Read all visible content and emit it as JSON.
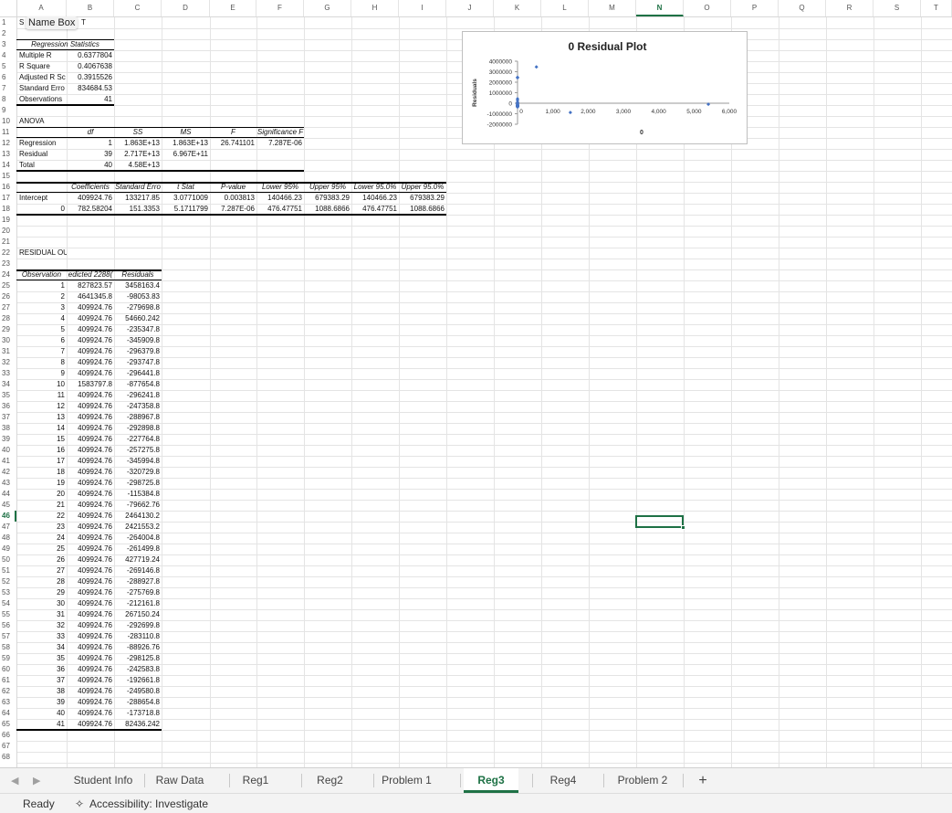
{
  "columns": [
    "A",
    "B",
    "C",
    "D",
    "E",
    "F",
    "G",
    "H",
    "I",
    "J",
    "K",
    "L",
    "M",
    "N",
    "O",
    "P",
    "Q",
    "R",
    "S",
    "T"
  ],
  "selected_column": "N",
  "selected_row": "46",
  "name_box": {
    "prefix": "S",
    "label": "Name Box",
    "suffix": "T"
  },
  "regression_statistics": {
    "title": "Regression Statistics",
    "rows": [
      [
        "Multiple R",
        "0.6377804"
      ],
      [
        "R Square",
        "0.4067638"
      ],
      [
        "Adjusted R Sc",
        "0.3915526"
      ],
      [
        "Standard Erro",
        "834684.53"
      ],
      [
        "Observations",
        "41"
      ]
    ]
  },
  "anova": {
    "title": "ANOVA",
    "headers": [
      "df",
      "SS",
      "MS",
      "F",
      "Significance F"
    ],
    "rows": [
      [
        "Regression",
        "1",
        "1.863E+13",
        "1.863E+13",
        "26.741101",
        "7.287E-06"
      ],
      [
        "Residual",
        "39",
        "2.717E+13",
        "6.967E+11",
        "",
        ""
      ],
      [
        "Total",
        "40",
        "4.58E+13",
        "",
        "",
        ""
      ]
    ]
  },
  "coefficients": {
    "headers": [
      "Coefficients",
      "Standard Erro",
      "t Stat",
      "P-value",
      "Lower 95%",
      "Upper 95%",
      "Lower 95.0%",
      "Upper 95.0%"
    ],
    "rows": [
      [
        "Intercept",
        "409924.76",
        "133217.85",
        "3.0771009",
        "0.003813",
        "140466.23",
        "679383.29",
        "140466.23",
        "679383.29"
      ],
      [
        "0",
        "782.58204",
        "151.3353",
        "5.1711799",
        "7.287E-06",
        "476.47751",
        "1088.6866",
        "476.47751",
        "1088.6866"
      ]
    ]
  },
  "residual_output": {
    "title": "RESIDUAL OUTPUT",
    "headers": [
      "Observation",
      "edicted 2288(",
      "Residuals"
    ],
    "rows": [
      [
        "1",
        "827823.57",
        "3458163.4"
      ],
      [
        "2",
        "4641345.8",
        "-98053.83"
      ],
      [
        "3",
        "409924.76",
        "-279698.8"
      ],
      [
        "4",
        "409924.76",
        "54660.242"
      ],
      [
        "5",
        "409924.76",
        "-235347.8"
      ],
      [
        "6",
        "409924.76",
        "-345909.8"
      ],
      [
        "7",
        "409924.76",
        "-296379.8"
      ],
      [
        "8",
        "409924.76",
        "-293747.8"
      ],
      [
        "9",
        "409924.76",
        "-296441.8"
      ],
      [
        "10",
        "1583797.8",
        "-877654.8"
      ],
      [
        "11",
        "409924.76",
        "-296241.8"
      ],
      [
        "12",
        "409924.76",
        "-247358.8"
      ],
      [
        "13",
        "409924.76",
        "-288967.8"
      ],
      [
        "14",
        "409924.76",
        "-292898.8"
      ],
      [
        "15",
        "409924.76",
        "-227764.8"
      ],
      [
        "16",
        "409924.76",
        "-257275.8"
      ],
      [
        "17",
        "409924.76",
        "-345994.8"
      ],
      [
        "18",
        "409924.76",
        "-320729.8"
      ],
      [
        "19",
        "409924.76",
        "-298725.8"
      ],
      [
        "20",
        "409924.76",
        "-115384.8"
      ],
      [
        "21",
        "409924.76",
        "-79662.76"
      ],
      [
        "22",
        "409924.76",
        "2464130.2"
      ],
      [
        "23",
        "409924.76",
        "2421553.2"
      ],
      [
        "24",
        "409924.76",
        "-264004.8"
      ],
      [
        "25",
        "409924.76",
        "-261499.8"
      ],
      [
        "26",
        "409924.76",
        "427719.24"
      ],
      [
        "27",
        "409924.76",
        "-269146.8"
      ],
      [
        "28",
        "409924.76",
        "-288927.8"
      ],
      [
        "29",
        "409924.76",
        "-275769.8"
      ],
      [
        "30",
        "409924.76",
        "-212161.8"
      ],
      [
        "31",
        "409924.76",
        "267150.24"
      ],
      [
        "32",
        "409924.76",
        "-292699.8"
      ],
      [
        "33",
        "409924.76",
        "-283110.8"
      ],
      [
        "34",
        "409924.76",
        "-88926.76"
      ],
      [
        "35",
        "409924.76",
        "-298125.8"
      ],
      [
        "36",
        "409924.76",
        "-242583.8"
      ],
      [
        "37",
        "409924.76",
        "-192661.8"
      ],
      [
        "38",
        "409924.76",
        "-249580.8"
      ],
      [
        "39",
        "409924.76",
        "-288654.8"
      ],
      [
        "40",
        "409924.76",
        "-173718.8"
      ],
      [
        "41",
        "409924.76",
        "82436.242"
      ]
    ]
  },
  "chart_data": {
    "type": "scatter",
    "title": "0 Residual Plot",
    "xlabel": "0",
    "ylabel": "Residuals",
    "xlim": [
      0,
      6000
    ],
    "ylim": [
      -2000000,
      4000000
    ],
    "x_ticks": [
      "1,000",
      "2,000",
      "3,000",
      "4,000",
      "5,000",
      "6,000"
    ],
    "y_ticks": [
      "4000000",
      "3000000",
      "2000000",
      "1000000",
      "0",
      "-1000000",
      "-2000000"
    ],
    "marker_color": "#4472c4",
    "points": [
      [
        0,
        -279698.8
      ],
      [
        0,
        54660.242
      ],
      [
        0,
        -235347.8
      ],
      [
        0,
        -345909.8
      ],
      [
        0,
        -296379.8
      ],
      [
        0,
        -293747.8
      ],
      [
        0,
        -296441.8
      ],
      [
        0,
        -296241.8
      ],
      [
        0,
        -247358.8
      ],
      [
        0,
        -288967.8
      ],
      [
        0,
        -292898.8
      ],
      [
        0,
        -227764.8
      ],
      [
        0,
        -257275.8
      ],
      [
        0,
        -345994.8
      ],
      [
        0,
        -320729.8
      ],
      [
        0,
        -298725.8
      ],
      [
        0,
        -115384.8
      ],
      [
        0,
        -79662.76
      ],
      [
        0,
        2464130.2
      ],
      [
        0,
        2421553.2
      ],
      [
        0,
        -264004.8
      ],
      [
        0,
        -261499.8
      ],
      [
        0,
        427719.24
      ],
      [
        0,
        -269146.8
      ],
      [
        0,
        -288927.8
      ],
      [
        0,
        -275769.8
      ],
      [
        0,
        -212161.8
      ],
      [
        0,
        267150.24
      ],
      [
        0,
        -292699.8
      ],
      [
        0,
        -283110.8
      ],
      [
        0,
        -88926.76
      ],
      [
        0,
        -298125.8
      ],
      [
        0,
        -242583.8
      ],
      [
        0,
        -192661.8
      ],
      [
        0,
        -249580.8
      ],
      [
        0,
        -288654.8
      ],
      [
        0,
        -173718.8
      ],
      [
        0,
        82436.242
      ],
      [
        535,
        3458163.4
      ],
      [
        1497,
        -877654.8
      ],
      [
        5407,
        -98053.83
      ]
    ]
  },
  "sheet_tabs": [
    "Student Info",
    "Raw Data",
    "Reg1",
    "Reg2",
    "Problem 1",
    "Reg3",
    "Reg4",
    "Problem 2"
  ],
  "active_tab": "Reg3",
  "add_sheet_label": "+",
  "status": {
    "ready": "Ready",
    "accessibility": "Accessibility: Investigate"
  },
  "accent_color": "#1e7145"
}
